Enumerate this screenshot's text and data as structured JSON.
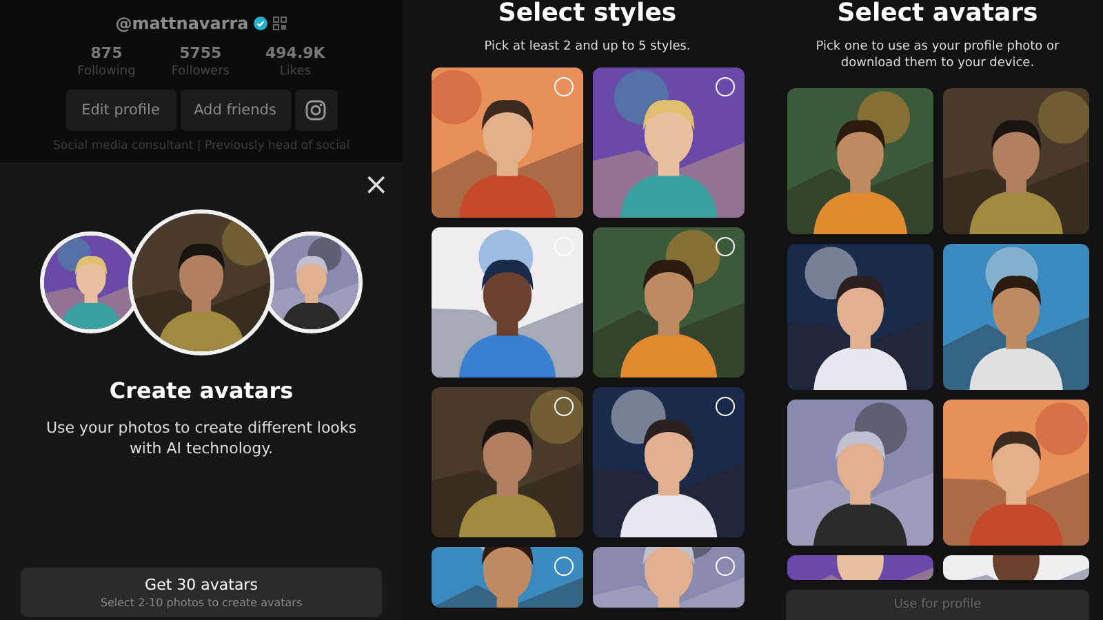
{
  "profile": {
    "handle": "@mattnavarra",
    "verified": true,
    "stats": [
      {
        "value": "875",
        "label": "Following"
      },
      {
        "value": "5755",
        "label": "Followers"
      },
      {
        "value": "494.9K",
        "label": "Likes"
      }
    ],
    "buttons": [
      "Edit profile",
      "Add friends"
    ],
    "bio": "Social media consultant | Previously head of social"
  },
  "sheet": {
    "close": "×",
    "title": "Create avatars",
    "description": "Use your photos to create different looks with AI technology.",
    "button": {
      "label": "Get 30 avatars",
      "sublabel": "Select 2-10 photos to create avatars"
    }
  },
  "styles": {
    "title": "Select styles",
    "subtitle": "Pick at least 2 and up to 5 styles."
  },
  "avatars": {
    "title": "Select avatars",
    "subtitle": "Pick one to use as your profile photo or download them to your device.",
    "button": {
      "label": "Use for profile",
      "disabled": true
    }
  }
}
